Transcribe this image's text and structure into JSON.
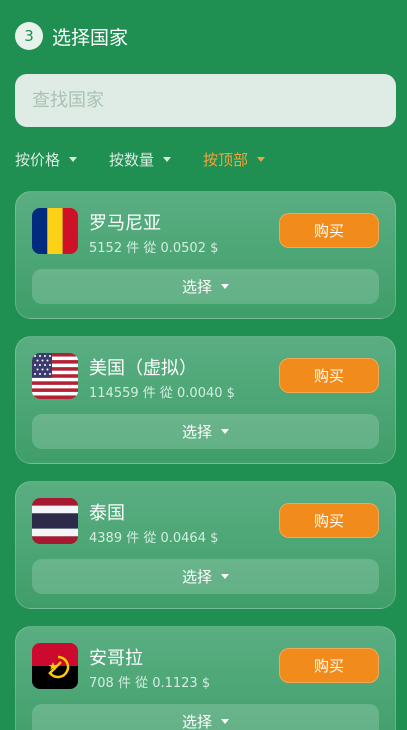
{
  "step": {
    "number": "3",
    "title": "选择国家"
  },
  "search": {
    "placeholder": "查找国家"
  },
  "sort": [
    {
      "label": "按价格",
      "active": false
    },
    {
      "label": "按数量",
      "active": false
    },
    {
      "label": "按顶部",
      "active": true
    }
  ],
  "colors": {
    "background": "#1f8f52",
    "accent": "#f08b1c",
    "active_sort": "#f0a33c"
  },
  "countries": [
    {
      "name": "罗马尼亚",
      "meta": "5152 件 從 0.0502 $",
      "buy_label": "购买",
      "select_label": "选择",
      "flag_icon": "romania-flag-icon"
    },
    {
      "name": "美国（虚拟）",
      "meta": "114559 件 從 0.0040 $",
      "buy_label": "购买",
      "select_label": "选择",
      "flag_icon": "usa-flag-icon"
    },
    {
      "name": "泰国",
      "meta": "4389 件 從 0.0464 $",
      "buy_label": "购买",
      "select_label": "选择",
      "flag_icon": "thailand-flag-icon"
    },
    {
      "name": "安哥拉",
      "meta": "708 件 從 0.1123 $",
      "buy_label": "购买",
      "select_label": "选择",
      "flag_icon": "angola-flag-icon"
    }
  ]
}
